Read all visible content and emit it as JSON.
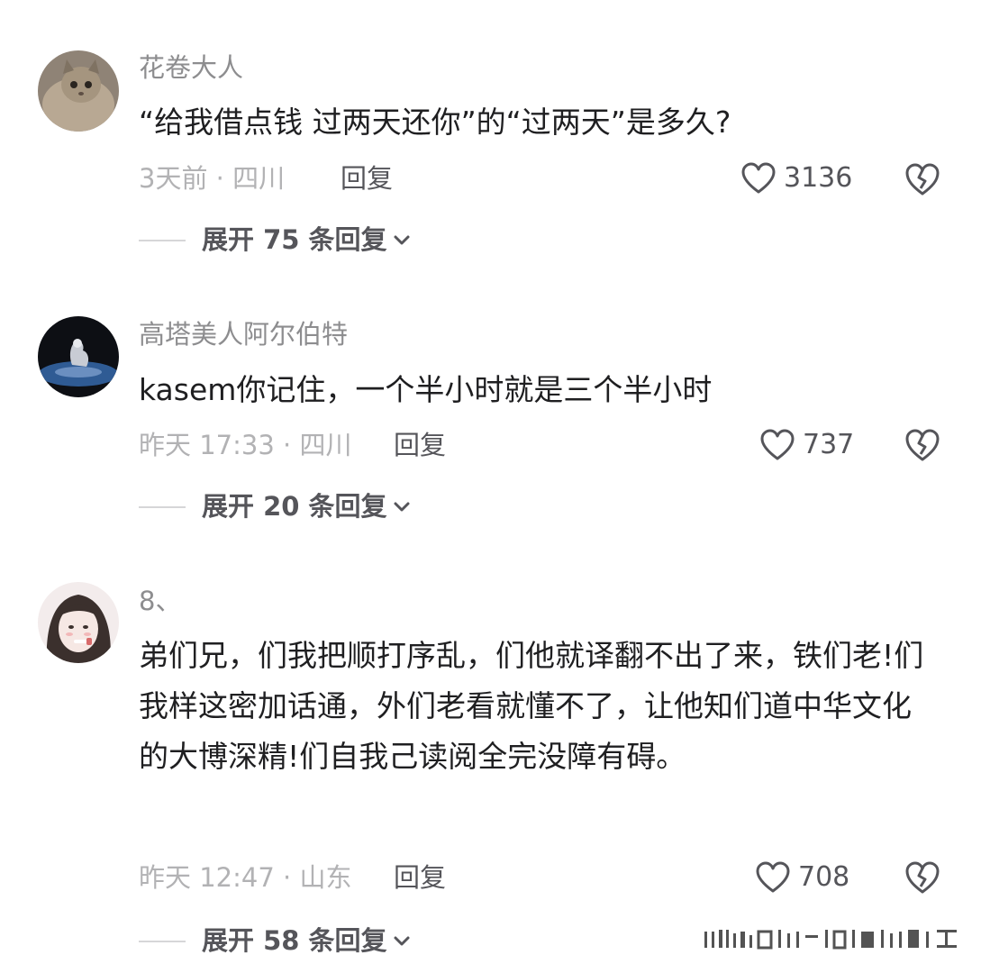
{
  "comments": [
    {
      "username": "花卷大人",
      "text": "“给我借点钱 过两天还你”的“过两天”是多久?",
      "meta": "3天前 · 四川",
      "reply_label": "回复",
      "likes": "3136",
      "expand_label": "展开 75 条回复",
      "avatar_icon": "cat-avatar-icon"
    },
    {
      "username": "高塔美人阿尔伯特",
      "text": "kasem你记住，一个半小时就是三个半小时",
      "meta": "昨天 17:33 · 四川",
      "reply_label": "回复",
      "likes": "737",
      "expand_label": "展开 20 条回复",
      "avatar_icon": "dark-scene-avatar-icon"
    },
    {
      "username": "8、",
      "text": "弟们兄，们我把顺打序乱，们他就译翻不出了来，铁们老!们我样这密加话通，外们老看就懂不了，让他知们道中华文化的大博深精!们自我己读阅全完没障有碍。",
      "meta": "昨天 12:47 · 山东",
      "reply_label": "回复",
      "likes": "708",
      "expand_label": "展开 58 条回复",
      "avatar_icon": "girl-avatar-icon"
    }
  ],
  "icons": {
    "like": "heart-outline-icon",
    "dislike": "broken-heart-icon",
    "expand": "chevron-down-icon"
  },
  "colors": {
    "username": "#8d8d8f",
    "text": "#1f1f21",
    "meta": "#b2b2b4",
    "action": "#55555a"
  }
}
